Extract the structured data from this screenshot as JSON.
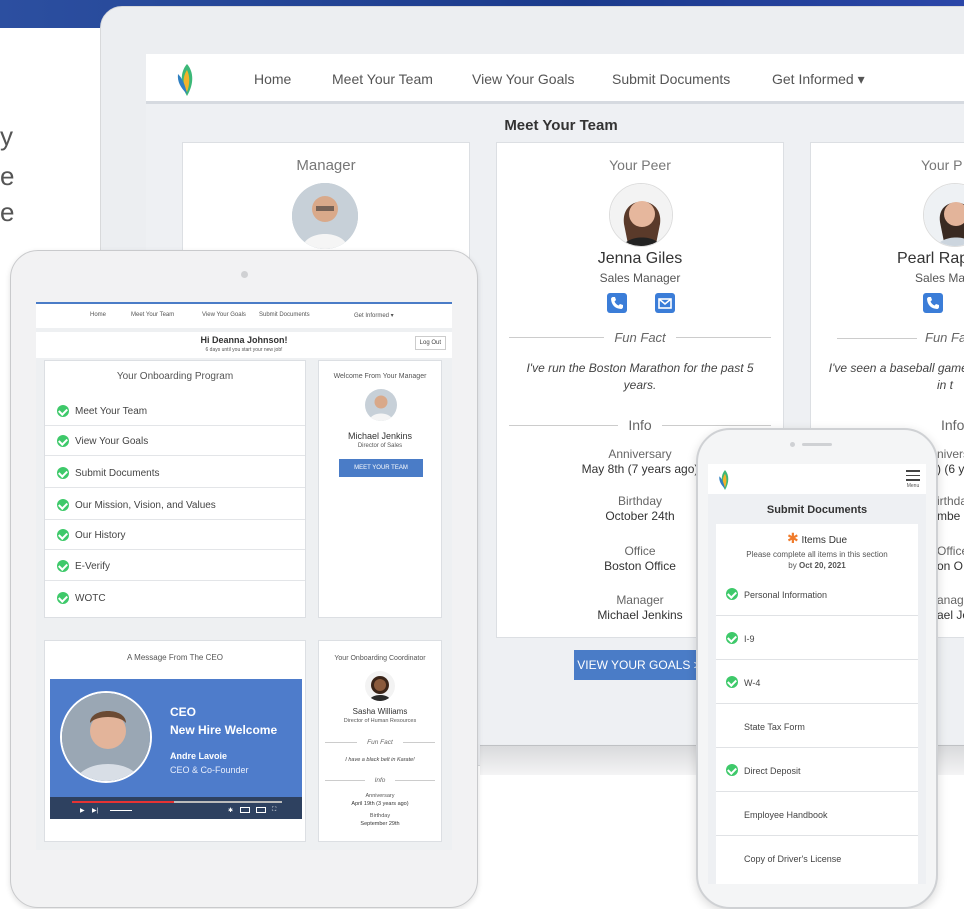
{
  "background": {
    "partial_text": [
      "y",
      "e",
      "e"
    ]
  },
  "laptop": {
    "nav": {
      "items": [
        "Home",
        "Meet Your Team",
        "View Your Goals",
        "Submit Documents",
        "Get Informed ▾"
      ]
    },
    "page_title": "Meet Your Team",
    "manager_card": {
      "title": "Manager"
    },
    "peer_card": {
      "title": "Your Peer",
      "name": "Jenna Giles",
      "role": "Sales Manager",
      "fun_fact_label": "Fun Fact",
      "fun_fact": "I've run the Boston Marathon for the past 5 years.",
      "info_label": "Info",
      "anniversary_label": "Anniversary",
      "anniversary": "May 8th (7 years ago)",
      "birthday_label": "Birthday",
      "birthday": "October 24th",
      "office_label": "Office",
      "office": "Boston Office",
      "manager_label": "Manager",
      "manager": "Michael Jenkins"
    },
    "peer2_card": {
      "title": "Your P",
      "name": "Pearl Rap",
      "role": "Sales Mar",
      "fun_fact_label": "Fun Fa",
      "fun_fact": "I've seen a baseball game baseball stadium in t",
      "info_label": "Info",
      "partial_lines": [
        "nivers",
        ") (6 y",
        "irthda",
        "mbe",
        "Office",
        "on O",
        "anag",
        "ael Je"
      ]
    },
    "goals_button": "VIEW YOUR GOALS >"
  },
  "tablet": {
    "nav": {
      "items": [
        "Home",
        "Meet Your Team",
        "View Your Goals",
        "Submit Documents",
        "Get Informed ▾"
      ]
    },
    "greeting": "Hi Deanna Johnson!",
    "subgreeting": "6 days until you start your new job!",
    "logout": "Log Out",
    "onboarding": {
      "title": "Your Onboarding Program",
      "items": [
        "Meet Your Team",
        "View Your Goals",
        "Submit Documents",
        "Our Mission, Vision, and Values",
        "Our History",
        "E-Verify",
        "WOTC"
      ]
    },
    "welcome": {
      "title": "Welcome From Your Manager",
      "name": "Michael Jenkins",
      "role": "Director of Sales",
      "button": "MEET YOUR TEAM"
    },
    "ceo": {
      "title": "A Message From The CEO",
      "video_label": "CEO",
      "video_title": "New Hire Welcome",
      "person": "Andre Lavoie",
      "person_role": "CEO & Co-Founder"
    },
    "coordinator": {
      "title": "Your Onboarding Coordinator",
      "name": "Sasha Williams",
      "role": "Director of Human Resources",
      "fun_fact_label": "Fun Fact",
      "fun_fact": "I have a black belt in Karate!",
      "info_label": "Info",
      "anniversary_label": "Anniversary",
      "anniversary": "April 19th (3 years ago)",
      "birthday_label": "Birthday",
      "birthday": "September 29th"
    }
  },
  "phone": {
    "menu_label": "Menu",
    "title": "Submit Documents",
    "items_due_label": "Items Due",
    "due_note": "Please complete all items in this section",
    "due_by": "by",
    "due_date": "Oct 20, 2021",
    "documents": [
      {
        "label": "Personal Information",
        "done": true
      },
      {
        "label": "I-9",
        "done": true
      },
      {
        "label": "W-4",
        "done": true
      },
      {
        "label": "State Tax Form",
        "done": false
      },
      {
        "label": "Direct Deposit",
        "done": true
      },
      {
        "label": "Employee Handbook",
        "done": false
      },
      {
        "label": "Copy of Driver's License",
        "done": false
      }
    ]
  },
  "colors": {
    "accent": "#4a7cc7",
    "check": "#3ec96a",
    "banner": "#2c4fa0",
    "items_due_star": "#f07b2b"
  }
}
